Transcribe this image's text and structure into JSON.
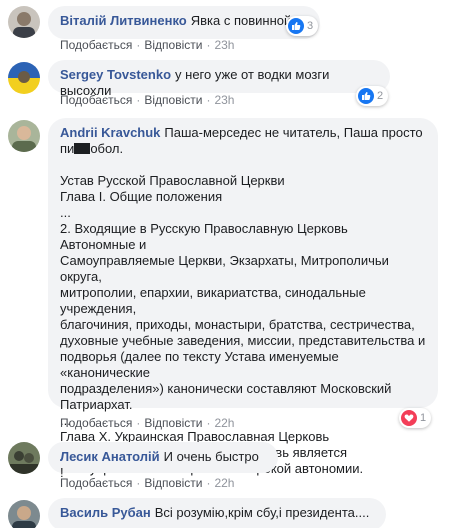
{
  "comments": [
    {
      "author": "Віталій Литвиненко",
      "text": "Явка с повинной",
      "actions": {
        "like": "Подобається",
        "reply": "Відповісти",
        "time": "23h"
      },
      "reactions": {
        "type": "like",
        "count": "3"
      }
    },
    {
      "author": "Sergey Tovstenko",
      "text": "у него уже от водки мозги высохли",
      "actions": {
        "like": "Подобається",
        "reply": "Відповісти",
        "time": "23h"
      },
      "reactions": {
        "type": "like",
        "count": "2"
      }
    },
    {
      "author": "Andrii Kravchuk",
      "text_before_redaction": "Паша-мерседес не читатель, Паша просто пи",
      "text_after_redaction": "обол.",
      "body_lines": "Устав Русской Православной Церкви\nГлава I. Общие положения\n...\n2. Входящие в Русскую Православную Церковь Автономные и\nСамоуправляемые Церкви, Экзархаты, Митрополичьи округа,\nмитрополии, епархии, викариатства, синодальные учреждения,\nблагочиния, приходы, монастыри, братства, сестричества,\nдуховные учебные заведения, миссии, представительства и\nподворья (далее по тексту Устава именуемые «канонические\nподразделения») канонически составляют Московский\nПатриархат.\n...\nГлава X. Украинская Православная Церковь\n1. Украинская Православная Церковь является\nсамоуправляемой с правами широкой автономии.",
      "actions": {
        "like": "Подобається",
        "reply": "Відповісти",
        "time": "22h"
      },
      "reactions": {
        "type": "love",
        "count": "1"
      }
    },
    {
      "author": "Лесик Анатолій",
      "text": "И очень быстро !",
      "actions": {
        "like": "Подобається",
        "reply": "Відповісти",
        "time": "22h"
      }
    },
    {
      "author": "Василь Рубан",
      "text": "Всі розумію,крім сбу,і президента...."
    }
  ],
  "colors": {
    "author": "#385898",
    "bubble": "#f2f3f5",
    "like": "#1877f2",
    "love": "#f33e58"
  }
}
